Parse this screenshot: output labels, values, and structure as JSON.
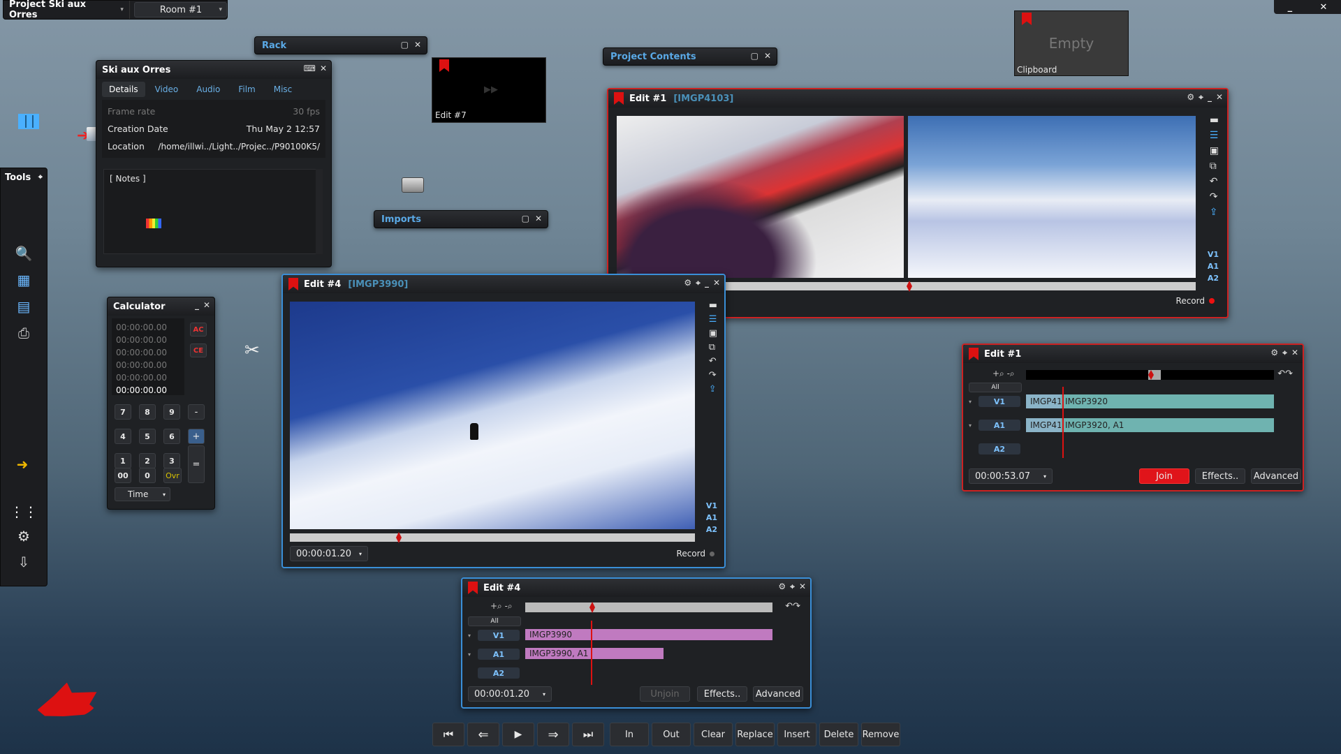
{
  "project": {
    "name": "Project Ski aux Orres",
    "room": "Room #1"
  },
  "rack": {
    "title": "Rack"
  },
  "project_contents": {
    "title": "Project Contents"
  },
  "imports": {
    "title": "Imports"
  },
  "clipboard": {
    "label": "Clipboard",
    "state": "Empty"
  },
  "edit7_tile": {
    "label": "Edit #7"
  },
  "details": {
    "title": "Ski aux Orres",
    "tabs": [
      "Details",
      "Video",
      "Audio",
      "Film",
      "Misc"
    ],
    "frame_rate_label": "Frame rate",
    "frame_rate_value": "30 fps",
    "creation_label": "Creation Date",
    "creation_value": "Thu May  2 12:57",
    "location_label": "Location",
    "location_value": "/home/illwi../Light../Projec../P90100K5/",
    "notes_label": "[ Notes ]"
  },
  "tools": {
    "title": "Tools"
  },
  "calculator": {
    "title": "Calculator",
    "history": [
      "00:00:00.00",
      "00:00:00.00",
      "00:00:00.00",
      "00:00:00.00",
      "00:00:00.00",
      "00:00:00.00"
    ],
    "keys": {
      "ac": "AC",
      "ce": "CE",
      "k7": "7",
      "k8": "8",
      "k9": "9",
      "minus": "-",
      "k4": "4",
      "k5": "5",
      "k6": "6",
      "plus": "+",
      "k1": "1",
      "k2": "2",
      "k3": "3",
      "equals": "=",
      "k00": "00",
      "k0": "0",
      "ovr": "Ovr"
    },
    "mode": "Time"
  },
  "viewer_edit1": {
    "title": "Edit #1",
    "clip": "[IMGP4103]",
    "tracks": [
      "V1",
      "A1",
      "A2"
    ],
    "record_label": "Record"
  },
  "viewer_edit4": {
    "title": "Edit #4",
    "clip": "[IMGP3990]",
    "tracks": [
      "V1",
      "A1",
      "A2"
    ],
    "timecode": "00:00:01.20",
    "record_label": "Record"
  },
  "timeline_edit1": {
    "title": "Edit #1",
    "all_label": "All",
    "tracks": {
      "v1": "V1",
      "a1": "A1",
      "a2": "A2"
    },
    "v1_clips": [
      "IMGP41",
      "IMGP3920"
    ],
    "a1_clips": [
      "IMGP41",
      "IMGP3920, A1"
    ],
    "timecode": "00:00:53.07",
    "join": "Join",
    "effects": "Effects..",
    "advanced": "Advanced"
  },
  "timeline_edit4": {
    "title": "Edit #4",
    "all_label": "All",
    "tracks": {
      "v1": "V1",
      "a1": "A1",
      "a2": "A2"
    },
    "v1_clip": "IMGP3990",
    "a1_clip": "IMGP3990, A1",
    "timecode": "00:00:01.20",
    "unjoin": "Unjoin",
    "effects": "Effects..",
    "advanced": "Advanced"
  },
  "transport": {
    "in": "In",
    "out": "Out",
    "clear": "Clear",
    "replace": "Replace",
    "insert": "Insert",
    "delete": "Delete",
    "remove": "Remove"
  },
  "colors": {
    "accent_blue": "#3a8fd8",
    "record_red": "#d11",
    "v_clip": "#6fb3b0",
    "a_clip_pink": "#c07ac0"
  }
}
